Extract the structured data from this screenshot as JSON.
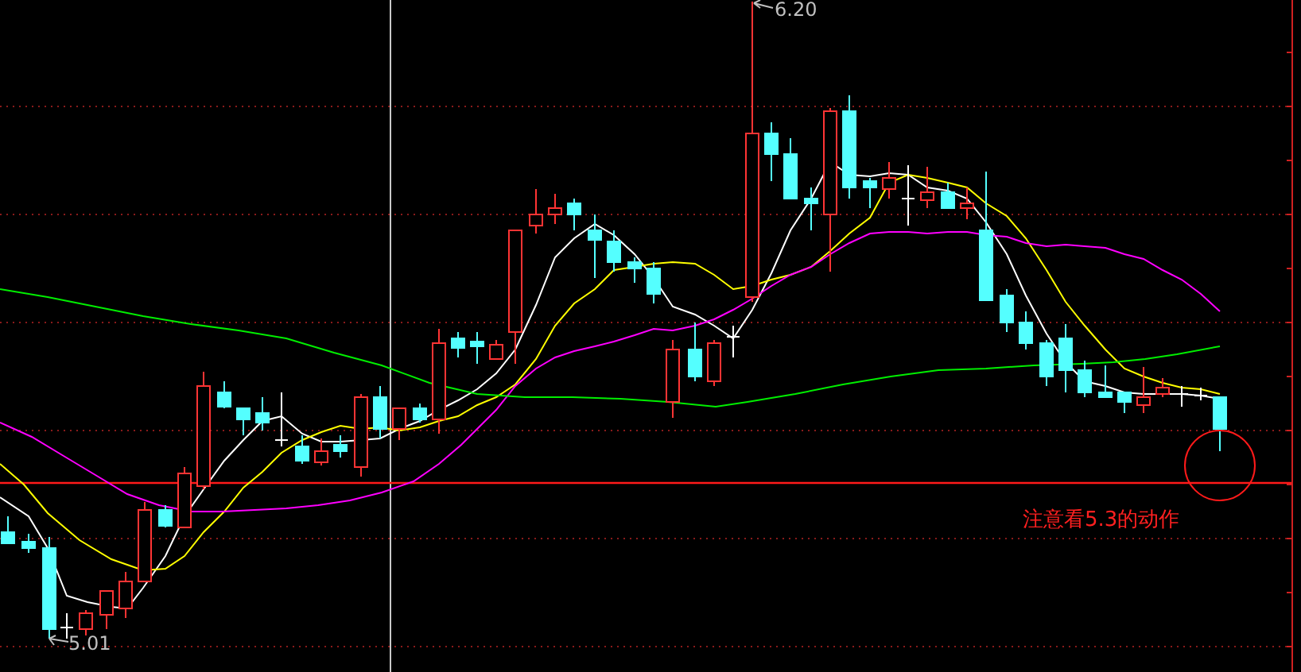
{
  "chart": {
    "high_label": "6.20",
    "low_label": "5.01",
    "annotation": "注意看5.3的动作"
  }
}
